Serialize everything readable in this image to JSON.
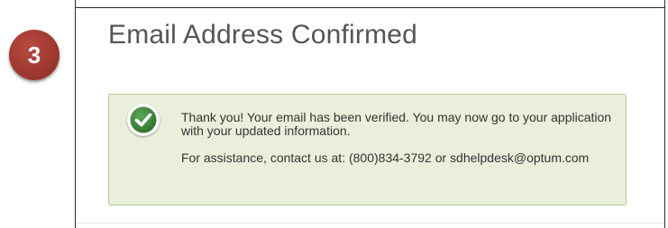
{
  "step": {
    "number": "3"
  },
  "page": {
    "title": "Email Address Confirmed"
  },
  "alert": {
    "icon": "check-circle-icon",
    "message_verified": "Thank you! Your email has been verified. You may now go to your application with your updated information.",
    "message_assistance": "For assistance, contact us at: (800)834-3792 or sdhelpdesk@optum.com"
  },
  "colors": {
    "badge": "#9f3a31",
    "alert_background": "#eaefdc",
    "alert_border": "#b7c98d",
    "check_green": "#3e8a3a",
    "title_text": "#555555"
  }
}
